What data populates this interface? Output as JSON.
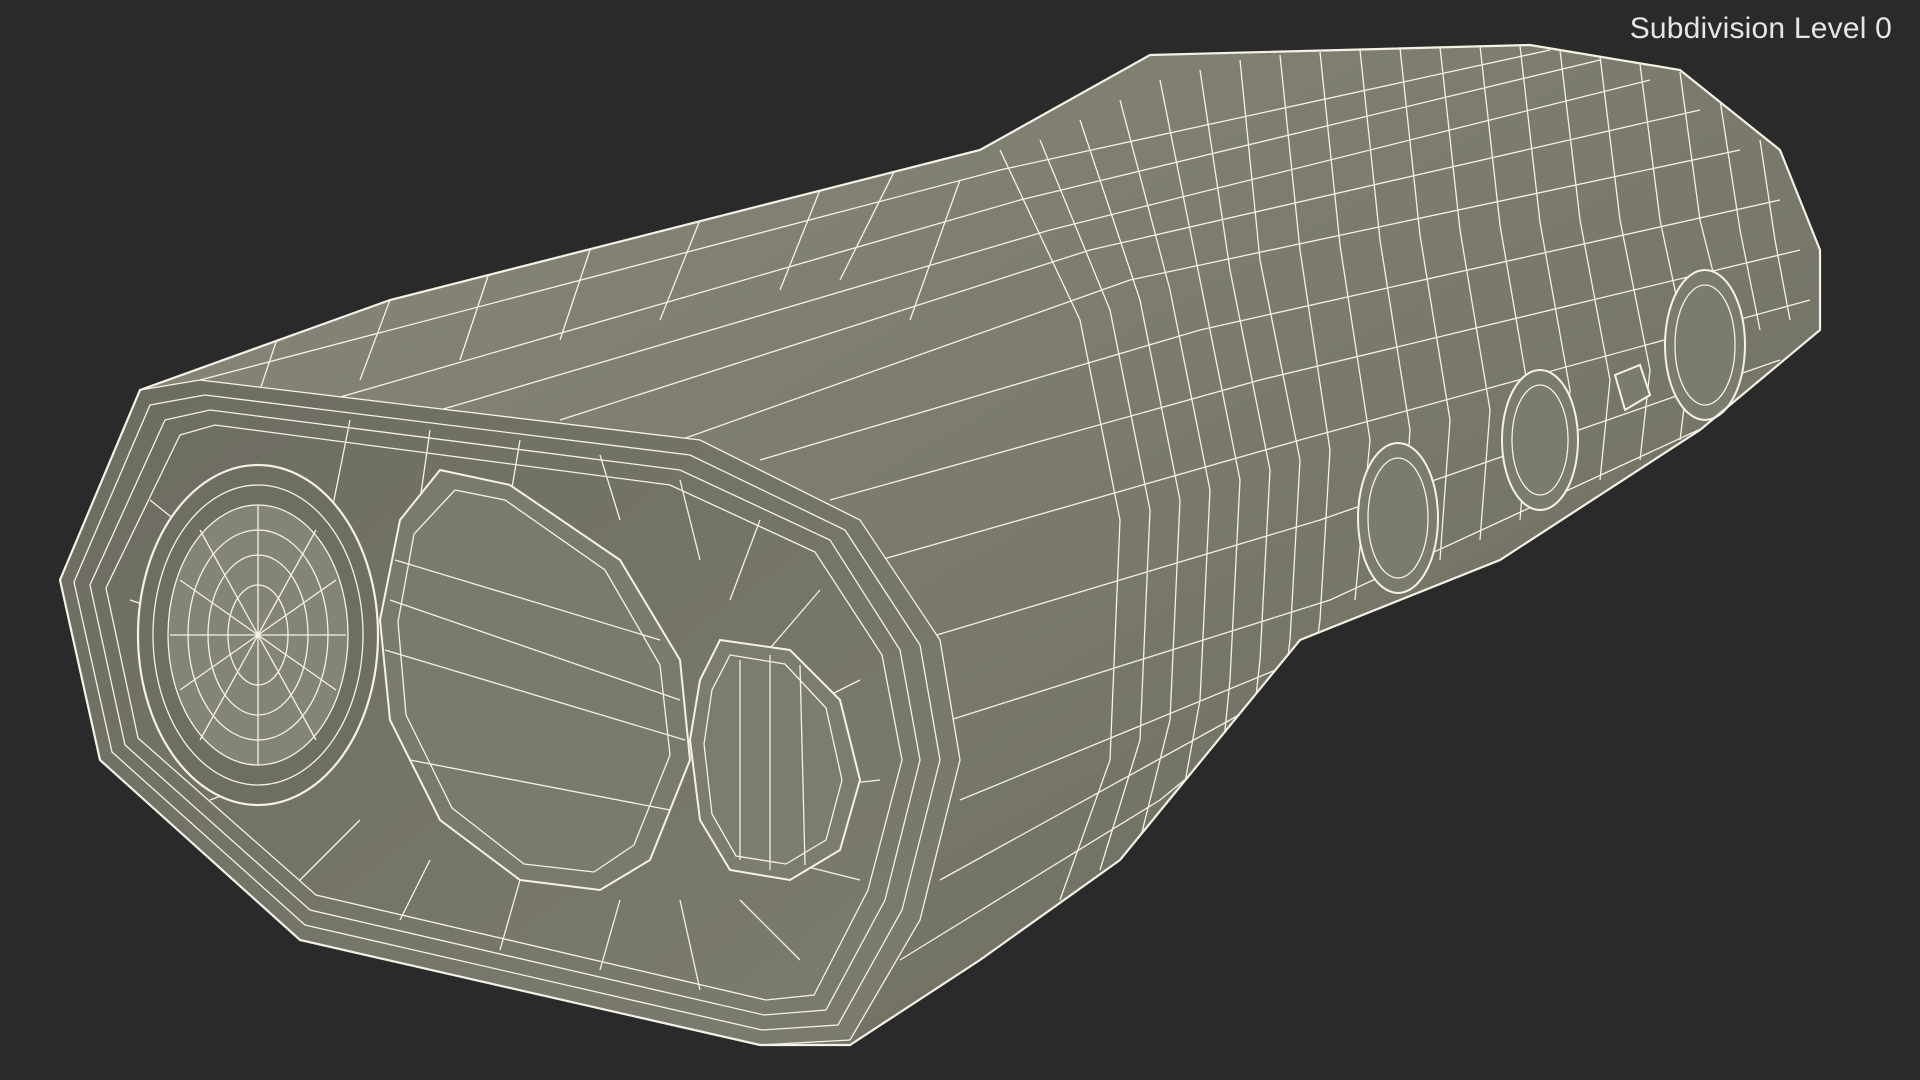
{
  "viewport": {
    "label": "Subdivision Level 0"
  },
  "colors": {
    "background": "#2a2a2a",
    "model_face": "#7b7a6d",
    "model_face_dark": "#6c6b60",
    "wire": "#f4f2e6"
  },
  "icons": {
    "model": "wireframe-device-model"
  }
}
